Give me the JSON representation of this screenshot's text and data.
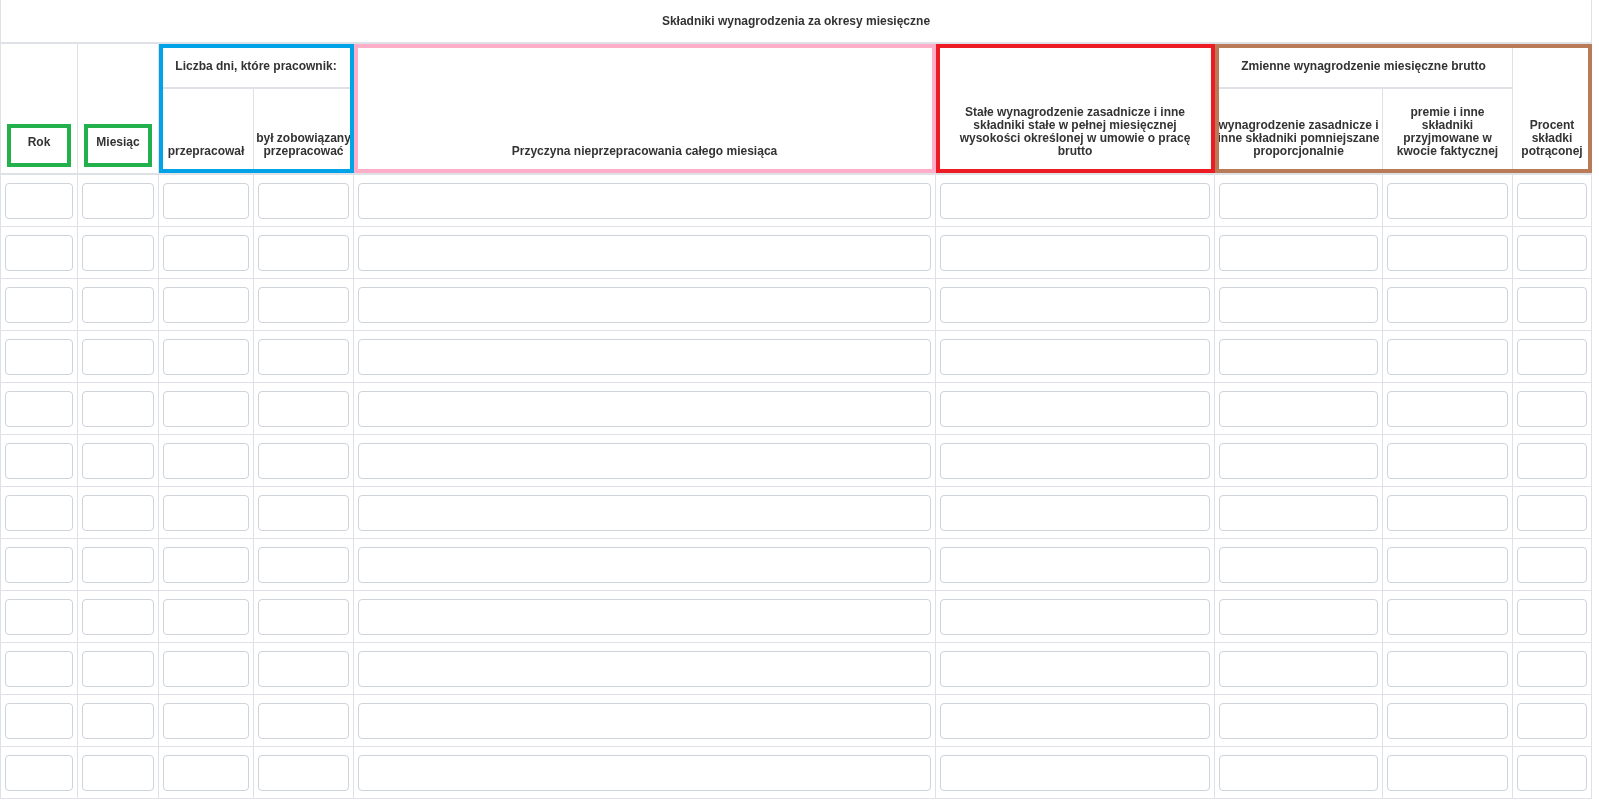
{
  "header": {
    "title": "Składniki wynagrodzenia za okresy miesięczne",
    "frames": [
      {
        "kind": "label",
        "color": "#22b14c",
        "columns": [
          {
            "label": "Rok"
          }
        ]
      },
      {
        "kind": "label",
        "color": "#22b14c",
        "columns": [
          {
            "label": "Miesiąc"
          }
        ]
      },
      {
        "kind": "column",
        "color": "#00a2e8",
        "columns": [
          {
            "label": "Liczba dni, które pracownik:",
            "children": [
              {
                "label": "przepracował"
              },
              {
                "label": "był zobowiązany przepracować"
              }
            ]
          }
        ]
      },
      {
        "kind": "column",
        "color": "#ffaec9",
        "columns": [
          {
            "label": "Przyczyna nieprzepracowania całego miesiąca"
          }
        ]
      },
      {
        "kind": "column",
        "color": "#ed1c24",
        "columns": [
          {
            "label": "Stałe wynagrodzenie zasadnicze i inne składniki stałe w pełnej miesięcznej wysokości określonej w umowie o pracę brutto"
          }
        ]
      },
      {
        "kind": "column",
        "color": "#b97a57",
        "columns": [
          {
            "label": "Zmienne wynagrodzenie miesięczne brutto",
            "children": [
              {
                "label": "wynagrodzenie zasadnicze i inne składniki pomniejszane proporcjonalnie"
              },
              {
                "label": "premie i inne składniki przyjmowane w kwocie faktycznej"
              }
            ]
          },
          {
            "label": "Procent składki potrąconej"
          }
        ]
      }
    ]
  },
  "rows": [
    {
      "kind": "blank"
    },
    {
      "kind": "blank"
    },
    {
      "kind": "blank"
    },
    {
      "kind": "blank"
    },
    {
      "kind": "blank"
    },
    {
      "kind": "blank"
    },
    {
      "kind": "blank"
    },
    {
      "kind": "blank"
    },
    {
      "kind": "blank"
    },
    {
      "kind": "blank"
    },
    {
      "kind": "blank"
    },
    {
      "kind": "blank"
    }
  ]
}
